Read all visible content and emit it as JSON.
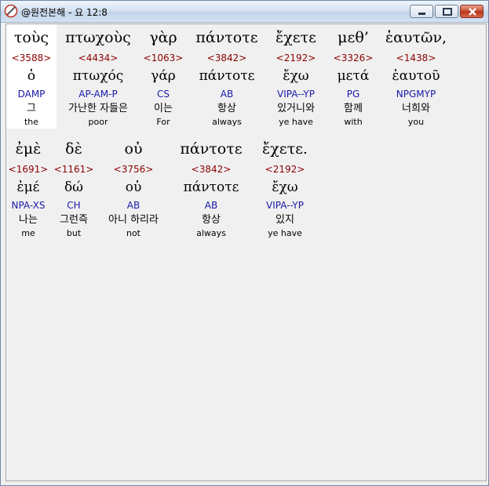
{
  "window": {
    "title": "@원전본해 - 요 12:8",
    "app_icon": "pencil-circle-icon",
    "buttons": [
      "minimize-icon",
      "maximize-icon",
      "close-icon"
    ]
  },
  "colors": {
    "strongs": "#8b0000",
    "morph": "#1a1aa8",
    "titlebar": "#d6e3f1",
    "close": "#c54a2f"
  },
  "lines": [
    {
      "words": [
        {
          "greek": "τοὺς",
          "strongs": "<3588>",
          "lemma": "ὁ",
          "morph": "DAMP",
          "korean": "그",
          "english": "the"
        },
        {
          "greek": "πτωχοὺς",
          "strongs": "<4434>",
          "lemma": "πτωχός",
          "morph": "AP-AM-P",
          "korean": "가난한 자들은",
          "english": "poor"
        },
        {
          "greek": "γὰρ",
          "strongs": "<1063>",
          "lemma": "γάρ",
          "morph": "CS",
          "korean": "이는",
          "english": "For"
        },
        {
          "greek": "πάντοτε",
          "strongs": "<3842>",
          "lemma": "πάντοτε",
          "morph": "AB",
          "korean": "항상",
          "english": "always"
        },
        {
          "greek": "ἔχετε",
          "strongs": "<2192>",
          "lemma": "ἔχω",
          "morph": "VIPA--YP",
          "korean": "있거니와",
          "english": "ye have"
        },
        {
          "greek": "μεθ’",
          "strongs": "<3326>",
          "lemma": "μετά",
          "morph": "PG",
          "korean": "함께",
          "english": "with"
        },
        {
          "greek": "ἑαυτῶν,",
          "strongs": "<1438>",
          "lemma": "ἑαυτοῦ",
          "morph": "NPGMYP",
          "korean": "너희와",
          "english": "you"
        }
      ]
    },
    {
      "words": [
        {
          "greek": "ἐμὲ",
          "strongs": "<1691>",
          "lemma": "ἐμέ",
          "morph": "NPA-XS",
          "korean": "나는",
          "english": "me"
        },
        {
          "greek": "δὲ",
          "strongs": "<1161>",
          "lemma": "δώ",
          "morph": "CH",
          "korean": "그런즉",
          "english": "but"
        },
        {
          "greek": "οὐ",
          "strongs": "<3756>",
          "lemma": "οὐ",
          "morph": "AB",
          "korean": "아니 하리라",
          "english": "not"
        },
        {
          "greek": "πάντοτε",
          "strongs": "<3842>",
          "lemma": "πάντοτε",
          "morph": "AB",
          "korean": "항상",
          "english": "always"
        },
        {
          "greek": "ἔχετε.",
          "strongs": "<2192>",
          "lemma": "ἔχω",
          "morph": "VIPA--YP",
          "korean": "있지",
          "english": "ye have"
        }
      ]
    }
  ]
}
